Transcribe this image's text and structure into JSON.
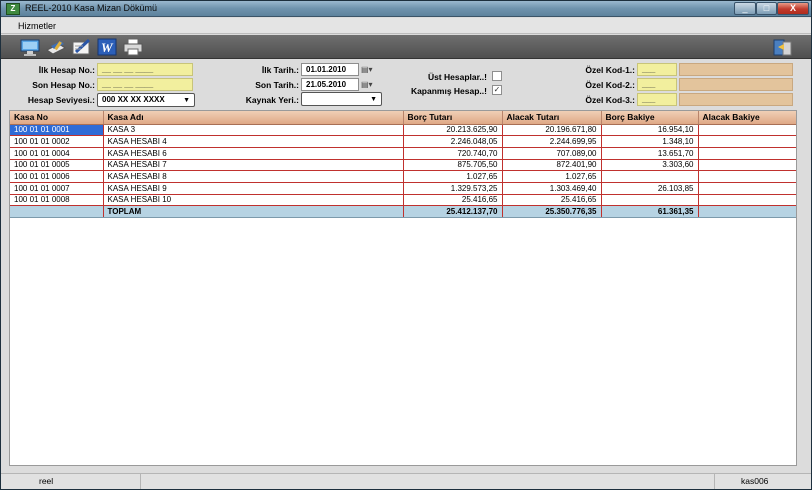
{
  "window": {
    "title": "REEL-2010 Kasa Mizan Dökümü",
    "app_icon_text": "Z",
    "minimize": "_",
    "maximize": "□",
    "close": "X"
  },
  "menu": {
    "items": [
      {
        "label": "Hizmetler"
      }
    ]
  },
  "toolbar": {
    "icons": [
      "monitor-icon",
      "edit-icon",
      "pen-icon",
      "word-icon",
      "printer-icon",
      "exit-icon"
    ]
  },
  "filter": {
    "ilk_hesap_label": "İlk Hesap No.:",
    "ilk_hesap_value": "__ __ __ ____",
    "son_hesap_label": "Son Hesap No.:",
    "son_hesap_value": "__ __ __ ____",
    "hesap_seviyesi_label": "Hesap Seviyesi.:",
    "hesap_seviyesi_value": "000 XX XX XXXX",
    "ilk_tarih_label": "İlk Tarih.:",
    "ilk_tarih_value": "01.01.2010",
    "son_tarih_label": "Son Tarih.:",
    "son_tarih_value": "21.05.2010",
    "kaynak_yeri_label": "Kaynak Yeri.:",
    "kaynak_yeri_value": "",
    "ust_hesaplar_label": "Üst Hesaplar..!",
    "ust_hesaplar_checked": "",
    "kapanmis_label": "Kapanmış Hesap..!",
    "kapanmis_checked": "✓",
    "ozel_kod_1_label": "Özel Kod-1.:",
    "ozel_kod_1_value": "___",
    "ozel_kod_2_label": "Özel Kod-2.:",
    "ozel_kod_2_value": "___",
    "ozel_kod_3_label": "Özel Kod-3.:",
    "ozel_kod_3_value": "___"
  },
  "grid": {
    "columns": [
      "Kasa No",
      "Kasa Adı",
      "Borç Tutarı",
      "Alacak Tutarı",
      "Borç Bakiye",
      "Alacak Bakiye"
    ],
    "rows": [
      [
        "100 01 01 0001",
        "KASA 3",
        "20.213.625,90",
        "20.196.671,80",
        "16.954,10",
        ""
      ],
      [
        "100 01 01 0002",
        "KASA HESABI 4",
        "2.246.048,05",
        "2.244.699,95",
        "1.348,10",
        ""
      ],
      [
        "100 01 01 0004",
        "KASA HESABI 6",
        "720.740,70",
        "707.089,00",
        "13.651,70",
        ""
      ],
      [
        "100 01 01 0005",
        "KASA HESABI 7",
        "875.705,50",
        "872.401,90",
        "3.303,60",
        ""
      ],
      [
        "100 01 01 0006",
        "KASA HESABI 8",
        "1.027,65",
        "1.027,65",
        "",
        ""
      ],
      [
        "100 01 01 0007",
        "KASA HESABI 9",
        "1.329.573,25",
        "1.303.469,40",
        "26.103,85",
        ""
      ],
      [
        "100 01 01 0008",
        "KASA HESABI 10",
        "25.416,65",
        "25.416,65",
        "",
        ""
      ]
    ],
    "total": [
      "",
      "TOPLAM",
      "25.412.137,70",
      "25.350.776,35",
      "61.361,35",
      ""
    ]
  },
  "status": {
    "user": "reel",
    "form_code": "kas006"
  }
}
